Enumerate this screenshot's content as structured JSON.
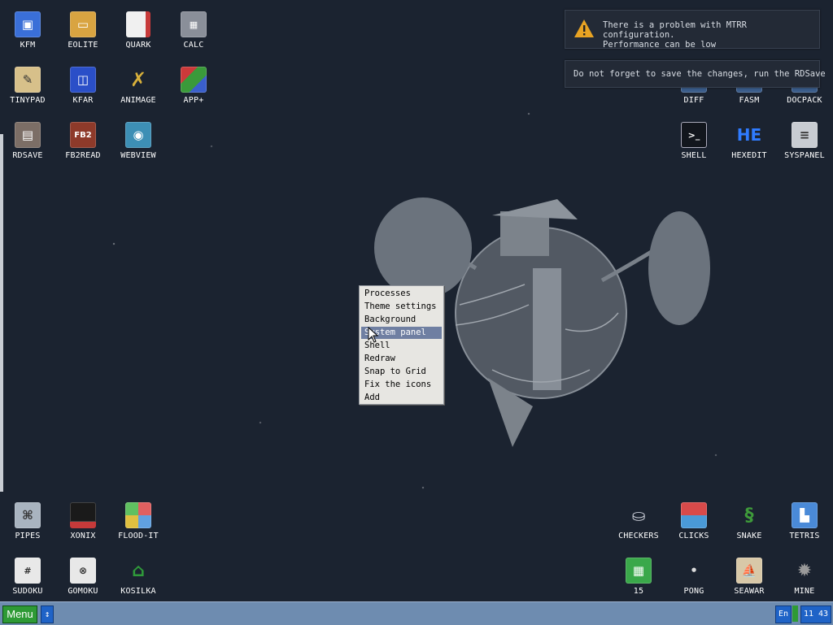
{
  "desktop": {
    "icons_top_left": [
      {
        "label": "KFM",
        "icon": "floppy-disk-icon",
        "color": "#3a6fd8"
      },
      {
        "label": "EOLITE",
        "icon": "folder-icon",
        "color": "#d9a441"
      },
      {
        "label": "QUARK",
        "icon": "notebook-icon",
        "color": "#c73a3a"
      },
      {
        "label": "CALC",
        "icon": "calculator-icon",
        "color": "#8a8f99"
      },
      {
        "label": "TINYPAD",
        "icon": "notepad-icon",
        "color": "#d7c08a"
      },
      {
        "label": "KFAR",
        "icon": "dual-panel-icon",
        "color": "#2a4fc8"
      },
      {
        "label": "ANIMAGE",
        "icon": "pencil-icon",
        "color": "#d8b03b"
      },
      {
        "label": "APP+",
        "icon": "cube-icon",
        "color": "#cc3a3a"
      },
      {
        "label": "RDSAVE",
        "icon": "save-disk-icon",
        "color": "#7c6e66"
      },
      {
        "label": "FB2READ",
        "icon": "book-icon",
        "color": "#8e3a2a"
      },
      {
        "label": "WEBVIEW",
        "icon": "globe-window-icon",
        "color": "#3d8fb5"
      }
    ],
    "icons_top_right": [
      {
        "label": "DIFF",
        "icon": "diff-icon",
        "color": "#3a5c8a"
      },
      {
        "label": "FASM",
        "icon": "assembler-icon",
        "color": "#3a5c8a"
      },
      {
        "label": "DOCPACK",
        "icon": "docpack-icon",
        "color": "#3a5c8a"
      },
      {
        "label": "SHELL",
        "icon": "terminal-icon",
        "color": "#12161d"
      },
      {
        "label": "HEXEDIT",
        "icon": "hex-editor-icon",
        "color": "#1c3d8f",
        "text": "HE"
      },
      {
        "label": "SYSPANEL",
        "icon": "sliders-icon",
        "color": "#c8ccd2"
      }
    ],
    "icons_bottom_left": [
      {
        "label": "PIPES",
        "icon": "pipes-icon",
        "color": "#a9b4c0"
      },
      {
        "label": "XONIX",
        "icon": "xonix-icon",
        "color": "#1a1a1a"
      },
      {
        "label": "FLOOD-IT",
        "icon": "flood-grid-icon",
        "color": "#e0a040"
      },
      {
        "label": "SUDOKU",
        "icon": "sudoku-icon",
        "color": "#e8e8e8"
      },
      {
        "label": "GOMOKU",
        "icon": "gomoku-icon",
        "color": "#e8e8e8"
      },
      {
        "label": "KOSILKA",
        "icon": "lawnmower-icon",
        "color": "#2f9a3a"
      }
    ],
    "icons_bottom_right": [
      {
        "label": "CHECKERS",
        "icon": "checkers-icon",
        "color": "#c8ccd6"
      },
      {
        "label": "CLICKS",
        "icon": "clicks-icon",
        "color": "#d84a4a"
      },
      {
        "label": "SNAKE",
        "icon": "snake-icon",
        "color": "#3e9a3a"
      },
      {
        "label": "TETRIS",
        "icon": "tetris-icon",
        "color": "#4a8ad8"
      },
      {
        "label": "15",
        "icon": "fifteen-grid-icon",
        "color": "#3aa84a"
      },
      {
        "label": "PONG",
        "icon": "pong-icon",
        "color": "#dcdcdc"
      },
      {
        "label": "SEAWAR",
        "icon": "seawar-icon",
        "color": "#d8c8a8"
      },
      {
        "label": "MINE",
        "icon": "mine-icon",
        "color": "#9a9a9a"
      }
    ]
  },
  "notifications": {
    "mtrr_line1": "There is a problem with MTRR configuration.",
    "mtrr_line2": "Performance can be low",
    "save_reminder": "Do not forget to save the changes, run the RDSave"
  },
  "context_menu": {
    "items": [
      {
        "label": "Processes"
      },
      {
        "label": "Theme settings"
      },
      {
        "label": "Background"
      },
      {
        "label": "System panel",
        "selected": true
      },
      {
        "label": "Shell"
      },
      {
        "label": "Redraw"
      },
      {
        "label": "Snap to Grid"
      },
      {
        "label": "Fix the icons"
      },
      {
        "label": "Add"
      }
    ]
  },
  "taskbar": {
    "menu_label": "Menu",
    "scroll_toggle": "↕",
    "language": "En",
    "clock": "11 43"
  }
}
